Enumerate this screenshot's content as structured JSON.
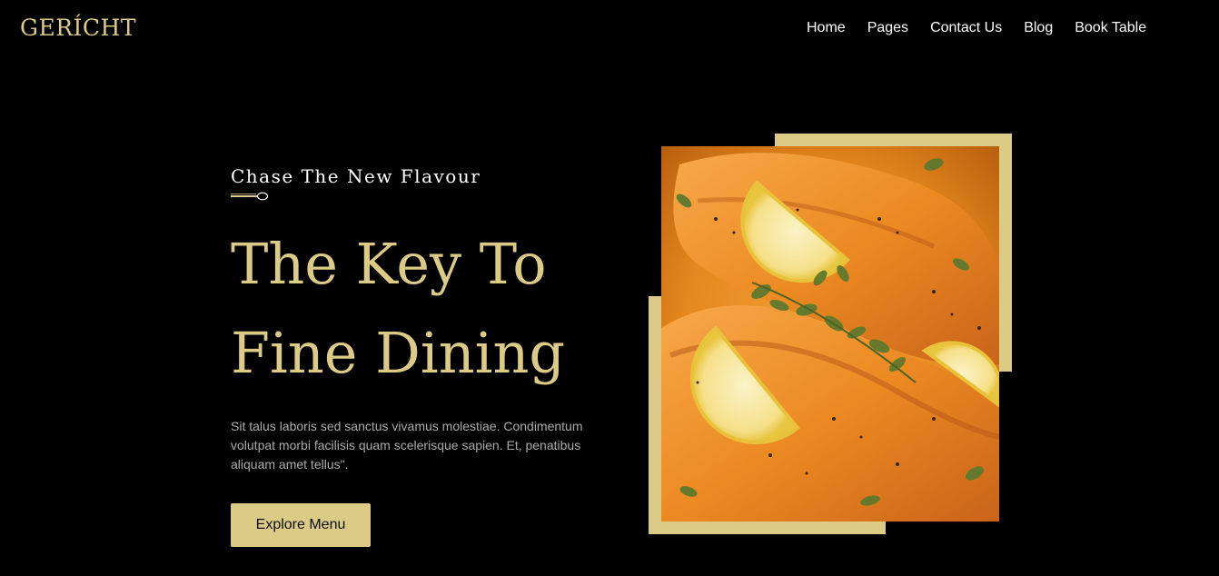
{
  "header": {
    "logo": "GERÍCHT",
    "nav": [
      {
        "label": "Home"
      },
      {
        "label": "Pages"
      },
      {
        "label": "Contact Us"
      },
      {
        "label": "Blog"
      },
      {
        "label": "Book Table"
      }
    ]
  },
  "hero": {
    "subtitle": "Chase The New Flavour",
    "spoon_icon": "spoon-icon",
    "headline_line1": "The Key To",
    "headline_line2": "Fine Dining",
    "description": "Sit talus laboris sed sanctus vivamus molestiae. Condimentum volutpat morbi facilisis quam scelerisque sapien. Et, penatibus aliquam amet tellus\".",
    "cta_label": "Explore Menu"
  },
  "colors": {
    "background": "#000000",
    "accent": "#DCCA87",
    "text": "#FFFFFF",
    "muted": "#AAAAAA"
  },
  "image": {
    "subject": "roasted salmon fillets with lemon slices and oregano"
  }
}
